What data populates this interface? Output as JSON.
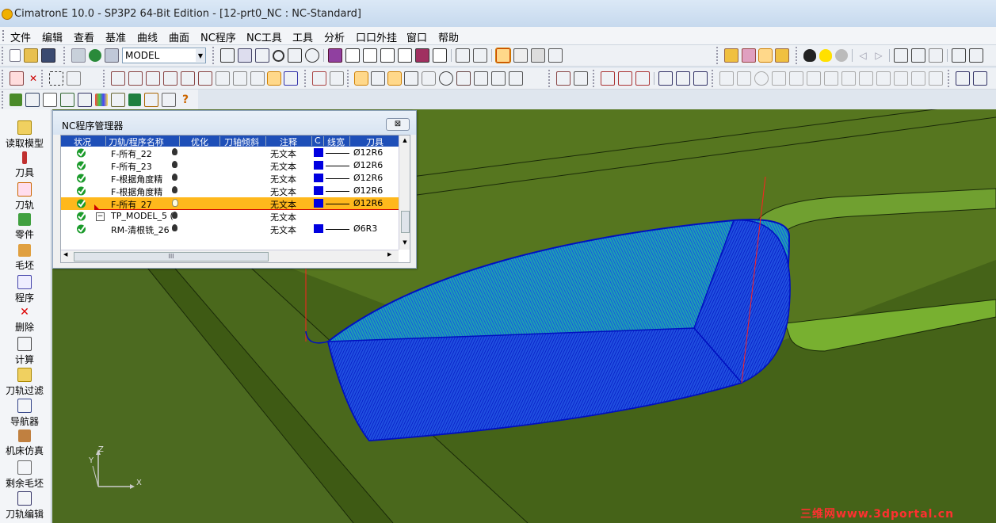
{
  "window": {
    "title": "CimatronE 10.0 - SP3P2 64-Bit Edition - [12-prt0_NC : NC-Standard]"
  },
  "menu": [
    "文件",
    "编辑",
    "查看",
    "基准",
    "曲线",
    "曲面",
    "NC程序",
    "NC工具",
    "工具",
    "分析",
    "口口外挂",
    "窗口",
    "帮助"
  ],
  "toolbar": {
    "model_select": "MODEL"
  },
  "left_toolbar": [
    "读取模型",
    "刀具",
    "刀轨",
    "零件",
    "毛坯",
    "程序",
    "删除",
    "计算",
    "刀轨过滤",
    "导航器",
    "机床仿真",
    "剩余毛坯",
    "刀轨编辑"
  ],
  "nc_panel": {
    "title": "NC程序管理器",
    "close_label": "⊠",
    "columns": [
      "状况",
      "刀轨/程序名称",
      "优化",
      "刀轴倾斜",
      "注释",
      "C",
      "线宽",
      "刀具"
    ],
    "rows": [
      {
        "name": "F-所有_22",
        "note": "无文本",
        "tool": "Ø12R6",
        "selected": false
      },
      {
        "name": "F-所有_23",
        "note": "无文本",
        "tool": "Ø12R6",
        "selected": false
      },
      {
        "name": "F-根据角度精",
        "note": "无文本",
        "tool": "Ø12R6",
        "selected": false
      },
      {
        "name": "F-根据角度精",
        "note": "无文本",
        "tool": "Ø12R6",
        "selected": false
      },
      {
        "name": "F-所有_27",
        "note": "无文本",
        "tool": "Ø12R6",
        "selected": true
      },
      {
        "name": "TP_MODEL_5 (",
        "note": "无文本",
        "tool": "",
        "selected": false
      },
      {
        "name": "RM-清根铣_26",
        "note": "无文本",
        "tool": "Ø6R3",
        "selected": false
      }
    ],
    "scrollbar_thumb": "III"
  },
  "axis": {
    "x": "X",
    "y": "Y",
    "z": "Z"
  },
  "watermark": "三维网www.3dportal.cn"
}
